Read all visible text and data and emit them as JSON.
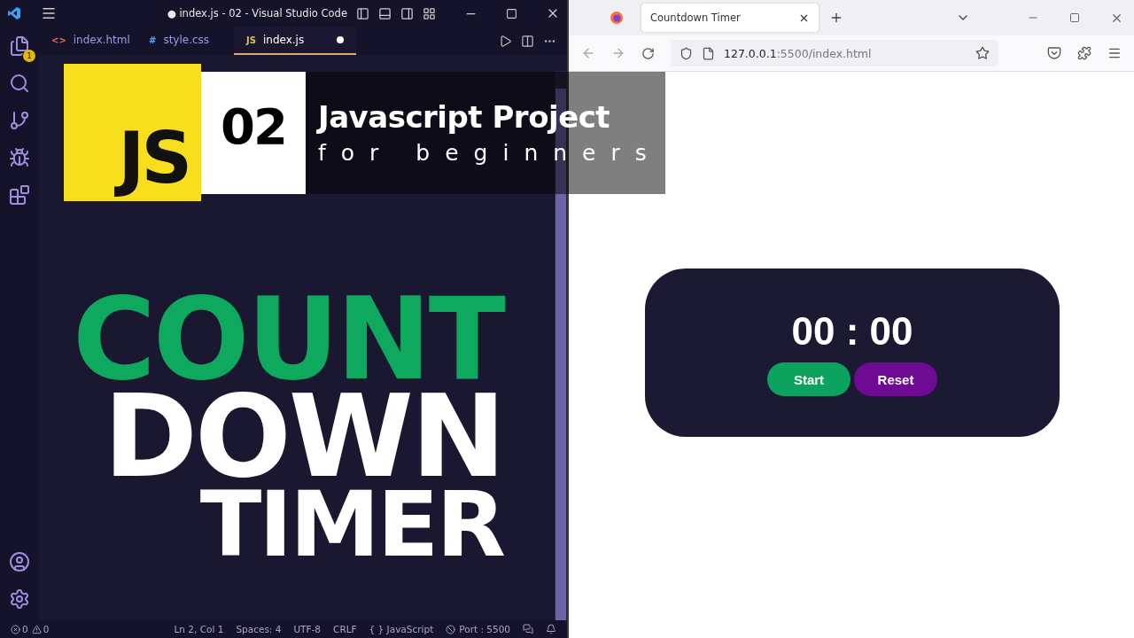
{
  "vscode": {
    "title": "● index.js - 02 - Visual Studio Code",
    "explorer_badge": "1",
    "tabs": [
      {
        "icon": "<>",
        "label": "index.html",
        "selected": false,
        "modified": false
      },
      {
        "icon": "#",
        "label": "style.css",
        "selected": false,
        "modified": false
      },
      {
        "icon": "JS",
        "label": "index.js",
        "selected": true,
        "modified": true
      }
    ],
    "status_bar": {
      "errors": "0",
      "warnings": "0",
      "items": [
        "Ln 2, Col 1",
        "Spaces: 4",
        "UTF-8",
        "CRLF",
        "{ } JavaScript",
        "Port : 5500"
      ]
    }
  },
  "overlay": {
    "badge": "JS",
    "number": "02",
    "title": "Javascript Project",
    "subtitle": "for beginners",
    "headline": [
      {
        "text": "COUNT",
        "color": "#0ea95f"
      },
      {
        "text": "DOWN",
        "color": "#ffffff"
      },
      {
        "text": "TIMER",
        "color": "#ffffff"
      }
    ]
  },
  "browser": {
    "tab_title": "Countdown Timer",
    "url_host": "127.0.0.1",
    "url_rest": ":5500/index.html",
    "timer": {
      "display": "00 : 00",
      "buttons": [
        {
          "label": "Start",
          "color": "#0ca35e"
        },
        {
          "label": "Reset",
          "color": "#6f0a95"
        }
      ]
    }
  }
}
